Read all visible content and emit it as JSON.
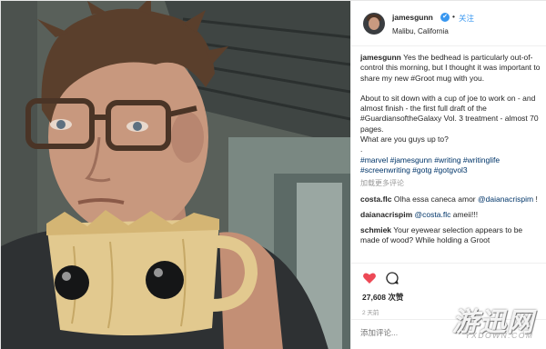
{
  "post": {
    "username": "jamesgunn",
    "follow_label": "关注",
    "location": "Malibu, California",
    "caption_user": "jamesgunn",
    "caption_text": " Yes the bedhead is particularly out-of-control this morning, but I thought it was important to share my new #Groot mug with you.",
    "caption_para2": "About to sit down with a cup of joe to work on - and almost finish - the first full draft of the #GuardiansoftheGalaxy Vol. 3 treatment - almost 70 pages.",
    "caption_para3": "What are you guys up to?",
    "caption_dot": ".",
    "hashtags": "#marvel #jamesgunn #writing #writinglife #screenwriting #gotg #gotgvol3",
    "load_more": "加载更多评论",
    "comments": [
      {
        "user": "costa.flc",
        "text": " Olha essa caneca amor ",
        "mention": "@daianacrispim",
        "tail": " !"
      },
      {
        "user": "daianacrispim",
        "text": " ",
        "mention": "@costa.flc",
        "tail": " ameii!!!"
      },
      {
        "user": "schmiek",
        "text": " Your eyewear selection appears to be made of wood? While holding a Groot",
        "mention": "",
        "tail": ""
      }
    ],
    "likes": "27,608 次赞",
    "time_ago": "2 天前",
    "add_comment_placeholder": "添加评论..."
  },
  "icons": {
    "like": "heart-icon",
    "comment": "speech-bubble-icon",
    "verified": "verified-badge-icon"
  },
  "colors": {
    "like_red": "#ed4956",
    "link_blue": "#3897f0",
    "hashtag_navy": "#003569"
  },
  "watermark": {
    "cn": "游迅网",
    "en": "YXDOWN.COM"
  }
}
